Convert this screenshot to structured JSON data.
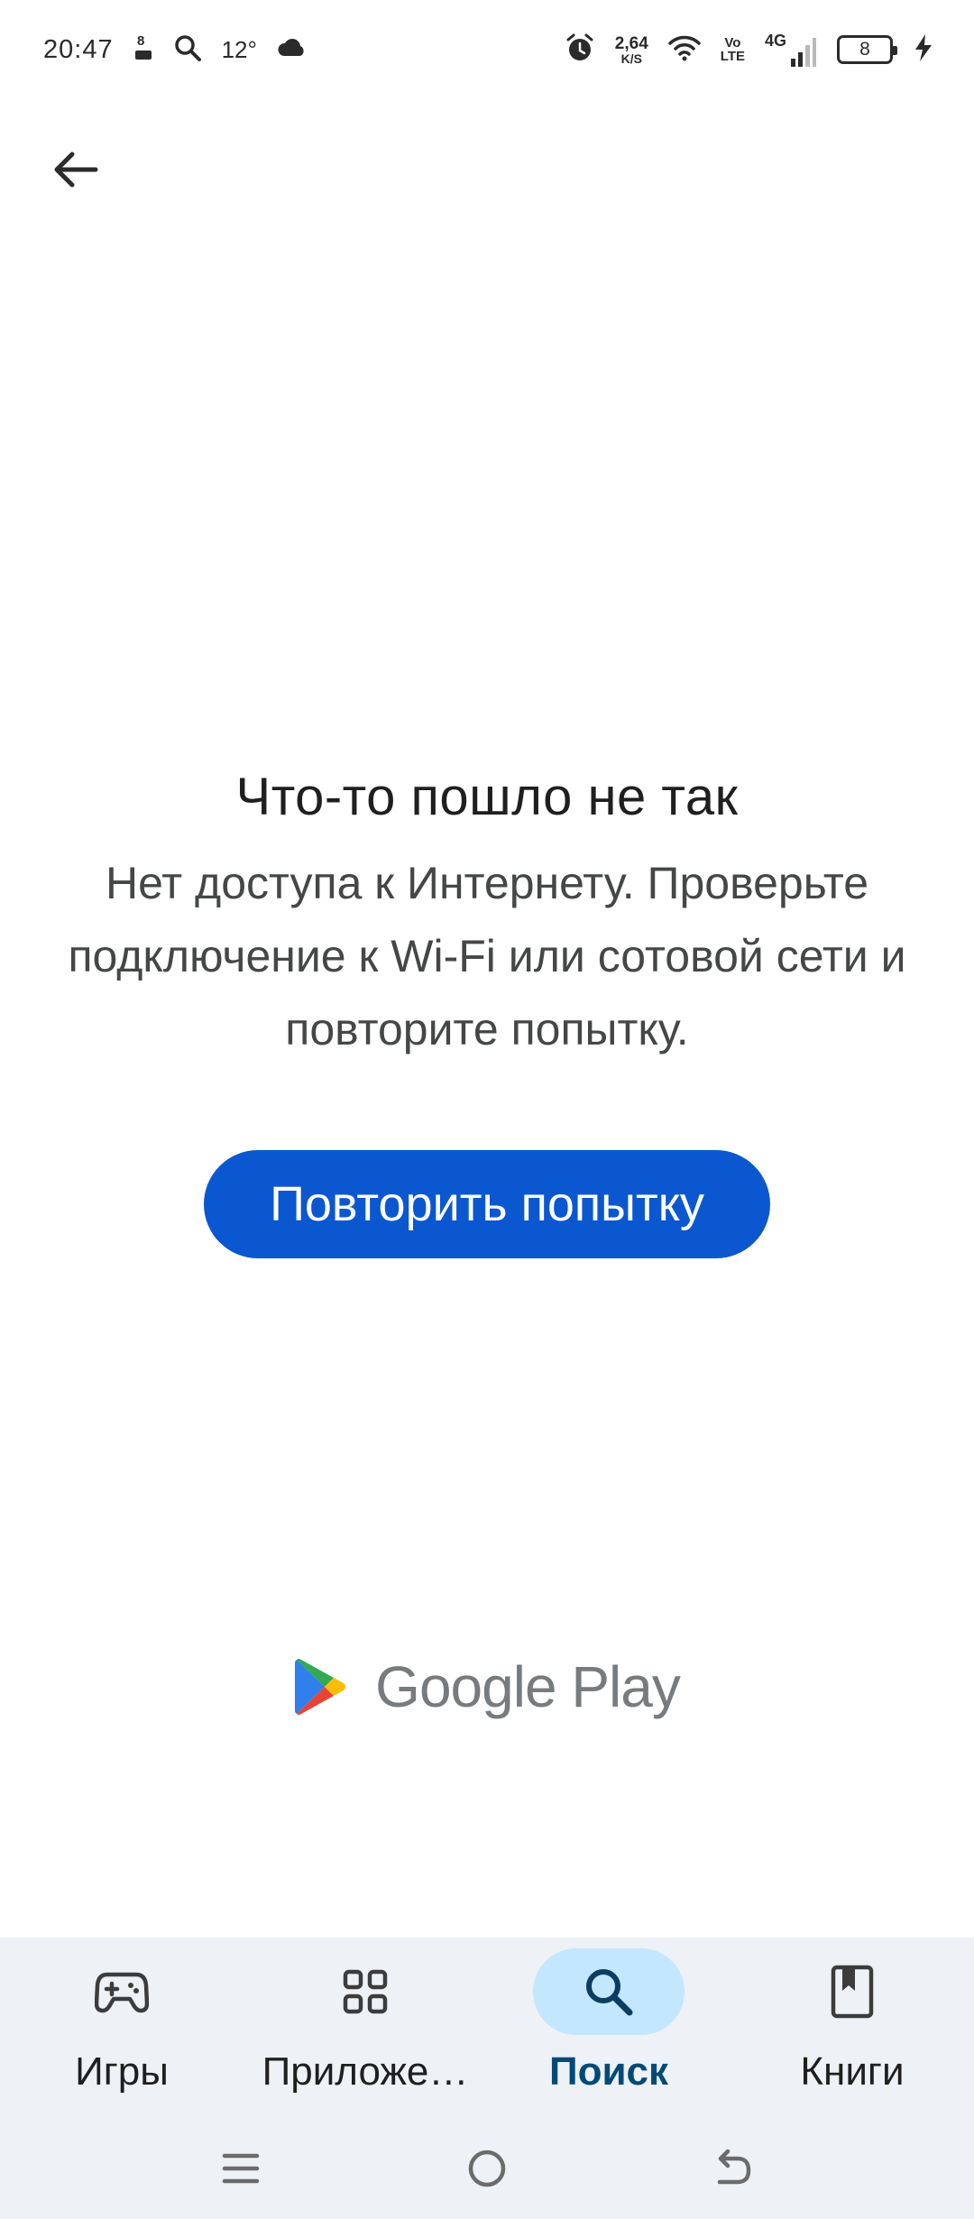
{
  "status_bar": {
    "time": "20:47",
    "temperature": "12°",
    "net_speed_value": "2,64",
    "net_speed_unit": "K/S",
    "volte_top": "Vo",
    "volte_bottom": "LTE",
    "network": "4G",
    "battery": "8"
  },
  "error": {
    "title": "Что-то пошло не так",
    "message": "Нет доступа к Интернету. Проверьте подключение к Wi-Fi или сотовой сети и повторите попытку.",
    "retry_label": "Повторить попытку"
  },
  "brand": {
    "name": "Google Play"
  },
  "bottom_nav": {
    "items": [
      {
        "label": "Игры",
        "icon": "gamepad-icon",
        "active": false
      },
      {
        "label": "Приложе…",
        "icon": "apps-grid-icon",
        "active": false
      },
      {
        "label": "Поиск",
        "icon": "search-icon",
        "active": true
      },
      {
        "label": "Книги",
        "icon": "book-icon",
        "active": false
      }
    ]
  },
  "colors": {
    "primary": "#0b57d0",
    "active_pill": "#c2e7ff",
    "nav_background": "#eef1f6"
  }
}
